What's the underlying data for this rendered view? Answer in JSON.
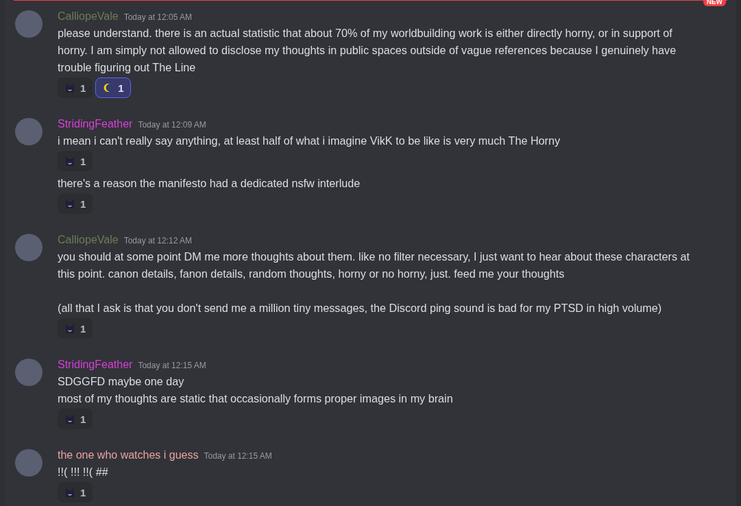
{
  "new_divider": {
    "badge": "NEW"
  },
  "messages": [
    {
      "username": "CalliopeVale",
      "color": "#6b7d55",
      "timestamp": "Today at 12:05 AM",
      "blocks": [
        {
          "text": "please understand. there is an actual statistic that about 70% of my worldbuilding work is either directly horny, or in support of horny. I am simply not allowed to disclose my thoughts in public spaces outside of vague references because I genuinely have trouble figuring out The Line",
          "reactions": [
            {
              "kind": "cat",
              "count": "1",
              "selected": false
            },
            {
              "kind": "moon",
              "count": "1",
              "selected": true
            }
          ]
        }
      ]
    },
    {
      "username": "StridingFeather",
      "color": "#d93fd9",
      "timestamp": "Today at 12:09 AM",
      "blocks": [
        {
          "text": "i mean i can't really say anything, at least half of what i imagine VikK to be like is very much The Horny",
          "reactions": [
            {
              "kind": "cat",
              "count": "1",
              "selected": false
            }
          ]
        },
        {
          "text": "there's a reason the manifesto had a dedicated nsfw interlude",
          "reactions": [
            {
              "kind": "cat",
              "count": "1",
              "selected": false
            }
          ]
        }
      ]
    },
    {
      "username": "CalliopeVale",
      "color": "#6b7d55",
      "timestamp": "Today at 12:12 AM",
      "blocks": [
        {
          "text": "you should at some point DM me more thoughts about them. like no filter necessary, I just want to hear about these characters at this point. canon details, fanon details, random thoughts, horny or no horny, just. feed me your thoughts\n\n(all that I ask is that you don't send me a million tiny messages, the Discord ping sound is bad for my PTSD in high volume)",
          "reactions": [
            {
              "kind": "cat",
              "count": "1",
              "selected": false
            }
          ]
        }
      ]
    },
    {
      "username": "StridingFeather",
      "color": "#d93fd9",
      "timestamp": "Today at 12:15 AM",
      "blocks": [
        {
          "text": "SDGGFD maybe one day\nmost of my thoughts are static that occasionally forms proper images in my brain",
          "reactions": [
            {
              "kind": "cat",
              "count": "1",
              "selected": false
            }
          ]
        }
      ]
    },
    {
      "username": "the one who watches i guess",
      "color": "#eba1a1",
      "timestamp": "Today at 12:15 AM",
      "blocks": [
        {
          "text": "!!( !!! !!( ##",
          "reactions": [
            {
              "kind": "cat",
              "count": "1",
              "selected": false
            }
          ]
        }
      ]
    }
  ]
}
